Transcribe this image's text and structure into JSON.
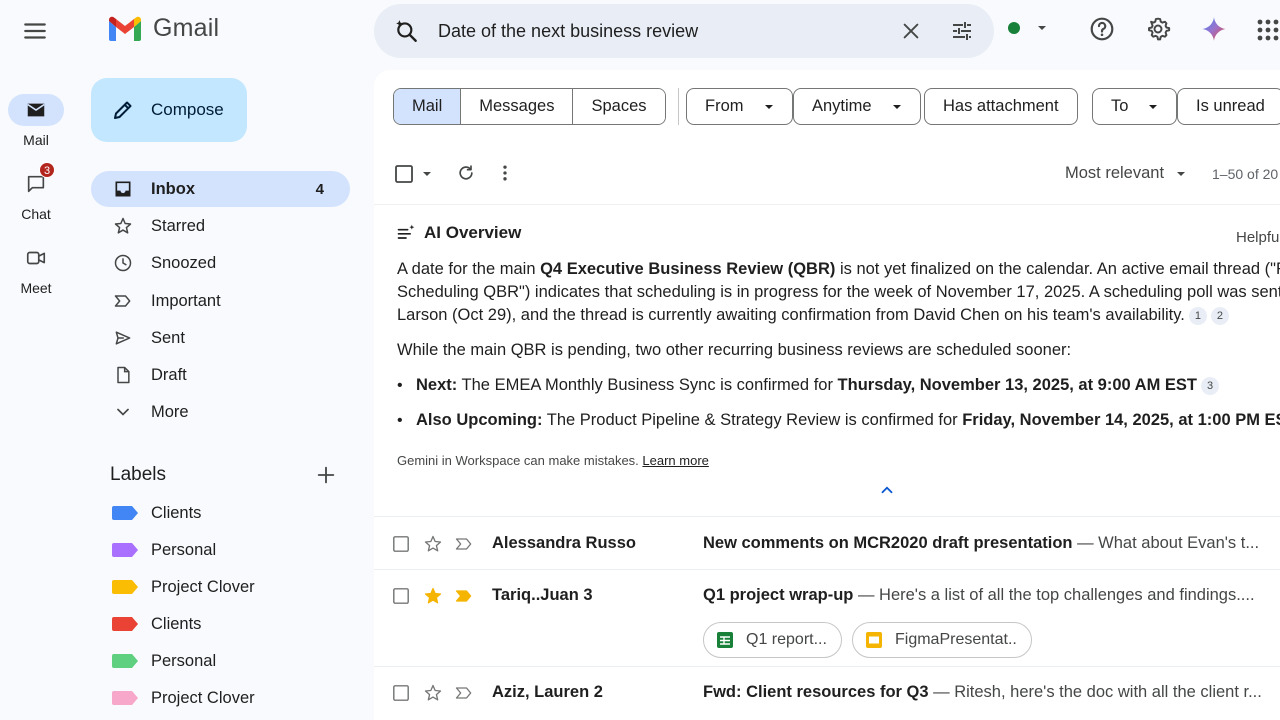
{
  "rail": {
    "mail": "Mail",
    "chat": "Chat",
    "chat_badge": "3",
    "meet": "Meet"
  },
  "brand": {
    "name": "Gmail"
  },
  "search": {
    "query": "Date of the next business review"
  },
  "compose": {
    "label": "Compose"
  },
  "nav": [
    {
      "label": "Inbox",
      "count": "4"
    },
    {
      "label": "Starred"
    },
    {
      "label": "Snoozed"
    },
    {
      "label": "Important"
    },
    {
      "label": "Sent"
    },
    {
      "label": "Draft"
    },
    {
      "label": "More"
    }
  ],
  "labels": {
    "title": "Labels",
    "items": [
      {
        "name": "Clients",
        "color": "#4285f4"
      },
      {
        "name": "Personal",
        "color": "#a970ff"
      },
      {
        "name": "Project Clover",
        "color": "#fbbc04"
      },
      {
        "name": "Clients",
        "color": "#ea4335"
      },
      {
        "name": "Personal",
        "color": "#5fcf80"
      },
      {
        "name": "Project Clover",
        "color": "#f7a7c9"
      }
    ]
  },
  "filters": {
    "segments": [
      "Mail",
      "Messages",
      "Spaces"
    ],
    "chips": [
      "From",
      "Anytime",
      "Has attachment",
      "To",
      "Is unread"
    ]
  },
  "toolbar": {
    "sort": "Most relevant",
    "range": "1–50 of 20"
  },
  "ai": {
    "title": "AI Overview",
    "helpful": "Helpfu",
    "p1_a": "A date for the main ",
    "p1_b": "Q4 Executive Business Review (QBR)",
    "p1_c": " is not yet finalized on the calendar. An active email thread (\"R",
    "p1_line2": "Scheduling QBR\") indicates that scheduling is in progress for the week of November 17, 2025. A scheduling poll was sent",
    "p1_line3": "Larson (Oct 29), and the thread is currently awaiting confirmation from David Chen on his team's availability.",
    "cite1": "1",
    "cite2": "2",
    "p2": "While the main QBR is pending, two other recurring business reviews are scheduled sooner:",
    "b1_label": "Next:",
    "b1_text": " The EMEA Monthly Business Sync is confirmed for ",
    "b1_date": "Thursday, November 13, 2025, at 9:00 AM EST",
    "cite3": "3",
    "b2_label": "Also Upcoming:",
    "b2_text": " The Product Pipeline & Strategy Review is confirmed for ",
    "b2_date": "Friday, November 14, 2025, at 1:00 PM ES",
    "disclaimer": "Gemini in Workspace can make mistakes. ",
    "learn_more": "Learn more"
  },
  "emails": [
    {
      "sender": "Alessandra Russo",
      "subject": "New comments on MCR2020 draft presentation",
      "snippet": " — What about Evan's t..."
    },
    {
      "sender": "Tariq..Juan 3",
      "subject": "Q1 project wrap-up",
      "snippet": " — Here's a list of all the top challenges and findings...."
    },
    {
      "sender": "Aziz, Lauren 2",
      "subject": "Fwd: Client resources for Q3",
      "snippet": " — Ritesh, here's the doc with all the client r..."
    }
  ],
  "attachments": [
    "Q1 report...",
    "FigmaPresentat.."
  ]
}
